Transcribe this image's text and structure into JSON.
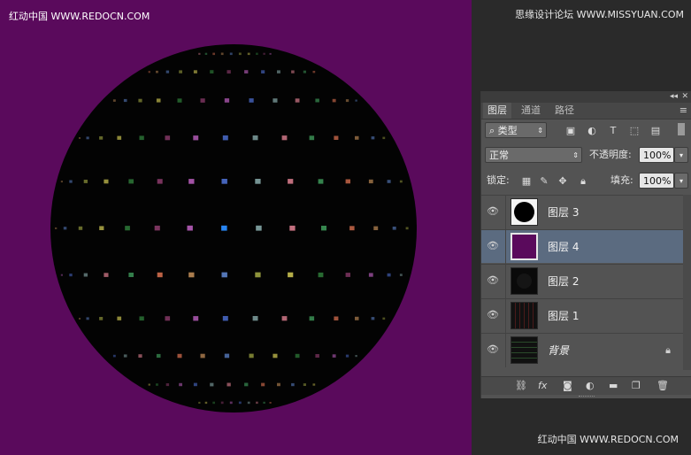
{
  "watermarks": {
    "top_left": "红动中国 WWW.REDOCN.COM",
    "top_right": "思缘设计论坛 WWW.MISSYUAN.COM",
    "bottom_right": "红动中国 WWW.REDOCN.COM"
  },
  "colors": {
    "canvas_bg": "#5a0a5c",
    "selected_row": "#5b6b80",
    "panel_bg": "#535353"
  },
  "panel": {
    "collapse_glyph": "◂◂",
    "close_glyph": "✕",
    "tabs": [
      {
        "label": "图层"
      },
      {
        "label": "通道"
      },
      {
        "label": "路径"
      }
    ],
    "menu_glyph": "≡",
    "filter_kind": "类型",
    "blend_mode": "正常",
    "opacity_label": "不透明度:",
    "opacity_value": "100%",
    "lock_label": "锁定:",
    "fill_label": "填充:",
    "fill_value": "100%",
    "layers": [
      {
        "name": "图层 3",
        "selected": false
      },
      {
        "name": "图层 4",
        "selected": true
      },
      {
        "name": "图层 2",
        "selected": false
      },
      {
        "name": "图层 1",
        "selected": false
      },
      {
        "name": "背景",
        "selected": false
      }
    ],
    "bottom_icons": [
      "link-icon",
      "fx-icon",
      "mask-icon",
      "adjustment-icon",
      "folder-icon",
      "new-layer-icon",
      "trash-icon"
    ],
    "fx_text": "fx"
  }
}
